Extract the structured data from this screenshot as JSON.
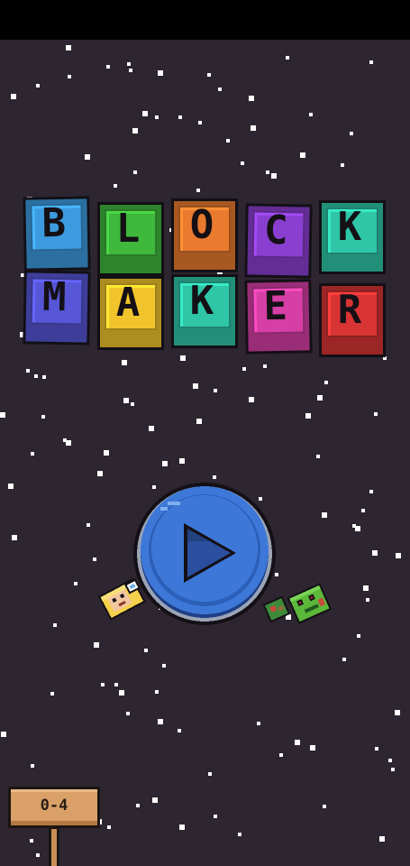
{
  "title": {
    "tiles": [
      {
        "letter": "B",
        "color": "#3d9be0"
      },
      {
        "letter": "L",
        "color": "#3fb83c"
      },
      {
        "letter": "O",
        "color": "#ea7a2e"
      },
      {
        "letter": "C",
        "color": "#8b3fd0"
      },
      {
        "letter": "K",
        "color": "#2fc6a8"
      },
      {
        "letter": "M",
        "color": "#5656d6"
      },
      {
        "letter": "A",
        "color": "#f2c42c"
      },
      {
        "letter": "K",
        "color": "#2fc6a8"
      },
      {
        "letter": "E",
        "color": "#d63fa6"
      },
      {
        "letter": "R",
        "color": "#d83434"
      }
    ]
  },
  "play": {
    "icon": "play-icon",
    "color": "#3d78d8"
  },
  "level_sign": {
    "label": "0-4"
  },
  "characters": {
    "left": "astronaut-icon",
    "right": "zombie-icon"
  },
  "colors": {
    "background": "#2d2530",
    "status_bar": "#000000",
    "star": "#ffffff"
  }
}
